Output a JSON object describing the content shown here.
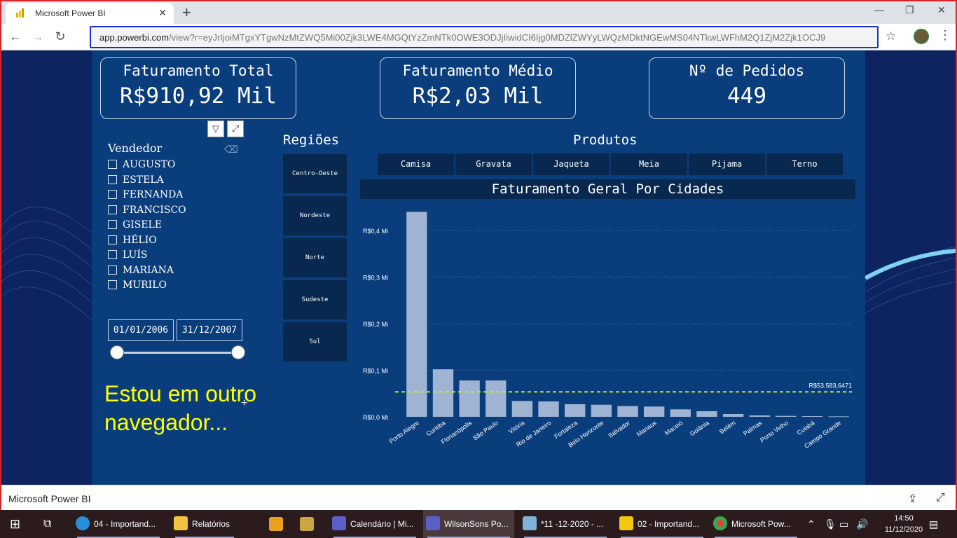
{
  "browser": {
    "tab_title": "Microsoft Power BI",
    "url_host": "app.powerbi.com",
    "url_path": "/view?r=eyJrIjoiMTgxYTgwNzMtZWQ5Mi00Zjk3LWE4MGQtYzZmNTk0OWE3ODJjIiwidCI6Ijg0MDZlZWYyLWQzMDktNGEwMS04NTkwLWFhM2Q1ZjM2Zjk1OCJ9"
  },
  "kpis": [
    {
      "title": "Faturamento Total",
      "value": "R$910,92 Mil"
    },
    {
      "title": "Faturamento Médio",
      "value": "R$2,03 Mil"
    },
    {
      "title": "Nº de Pedidos",
      "value": "449"
    }
  ],
  "vendedor": {
    "title": "Vendedor",
    "items": [
      "AUGUSTO",
      "ESTELA",
      "FERNANDA",
      "FRANCISCO",
      "GISELE",
      "HÉLIO",
      "LUÍS",
      "MARIANA",
      "MURILO"
    ]
  },
  "date_range": {
    "start": "01/01/2006",
    "end": "31/12/2007"
  },
  "regioes": {
    "title": "Regiões",
    "items": [
      "Centro-Oeste",
      "Nordeste",
      "Norte",
      "Sudeste",
      "Sul"
    ]
  },
  "produtos": {
    "title": "Produtos",
    "items": [
      "Camisa",
      "Gravata",
      "Jaqueta",
      "Meia",
      "Pijama",
      "Terno"
    ]
  },
  "overlay": {
    "line1": "Estou em outro",
    "line2": "navegador..."
  },
  "chart_data": {
    "type": "bar",
    "title": "Faturamento Geral Por Cidades",
    "categories": [
      "Porto Alegre",
      "Curitiba",
      "Florianópolis",
      "São Paulo",
      "Vitória",
      "Rio de Janeiro",
      "Fortaleza",
      "Belo Horizonte",
      "Salvador",
      "Manaus",
      "Maceió",
      "Goiânia",
      "Belém",
      "Palmas",
      "Porto Velho",
      "Cuiabá",
      "Campo Grande"
    ],
    "values": [
      0.44,
      0.102,
      0.078,
      0.078,
      0.034,
      0.033,
      0.027,
      0.026,
      0.023,
      0.022,
      0.016,
      0.012,
      0.006,
      0.003,
      0.002,
      0.0015,
      0.001
    ],
    "y_ticks": [
      "R$0,0 Mi",
      "R$0,1 Mi",
      "R$0,2 Mi",
      "R$0,3 Mi",
      "R$0,4 Mi"
    ],
    "ylim": [
      0,
      0.44
    ],
    "average_line": {
      "value": 0.0536,
      "label": "R$53.583,6471"
    },
    "bar_color": "#9fb3d3",
    "grid": true
  },
  "pbi_bar": {
    "title": "Microsoft Power BI"
  },
  "taskbar": {
    "items": [
      "04 - Importand...",
      "Relatórios",
      "Calendário | Mi...",
      "WilsonSons Po...",
      "*11 -12-2020 - ...",
      "02 - Importand...",
      "Microsoft Pow..."
    ],
    "time": "14:50",
    "date": "11/12/2020"
  }
}
